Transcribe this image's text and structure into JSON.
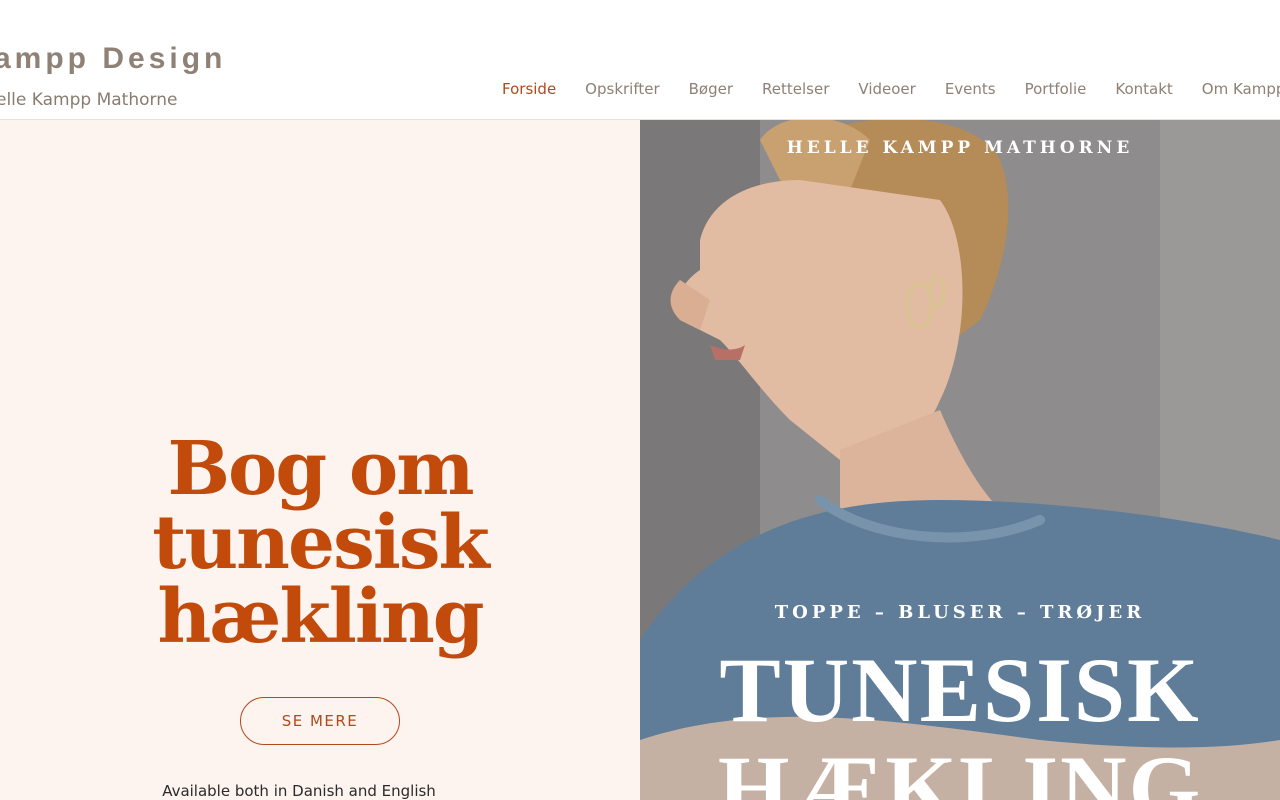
{
  "header": {
    "site_title": "ampp Design",
    "site_subtitle": "elle Kampp Mathorne",
    "nav": [
      {
        "label": "Forside",
        "active": true
      },
      {
        "label": "Opskrifter",
        "active": false
      },
      {
        "label": "Bøger",
        "active": false
      },
      {
        "label": "Rettelser",
        "active": false
      },
      {
        "label": "Videoer",
        "active": false
      },
      {
        "label": "Events",
        "active": false
      },
      {
        "label": "Portfolie",
        "active": false
      },
      {
        "label": "Kontakt",
        "active": false
      },
      {
        "label": "Om Kampp D",
        "active": false
      }
    ]
  },
  "hero": {
    "headline_lines": [
      "Bog om",
      "tunesisk",
      "hækling"
    ],
    "cta_label": "SE MERE",
    "availability": "Available both in Danish and English"
  },
  "cover": {
    "author": "HELLE KAMPP MATHORNE",
    "tagline": "TOPPE – BLUSER – TRØJER",
    "title_line_1": "TUNESISK",
    "title_line_2": "HÆKLING"
  },
  "colors": {
    "accent": "#c24a0a",
    "left_panel_bg": "#fdf3ef",
    "nav_text": "#8f8074"
  }
}
